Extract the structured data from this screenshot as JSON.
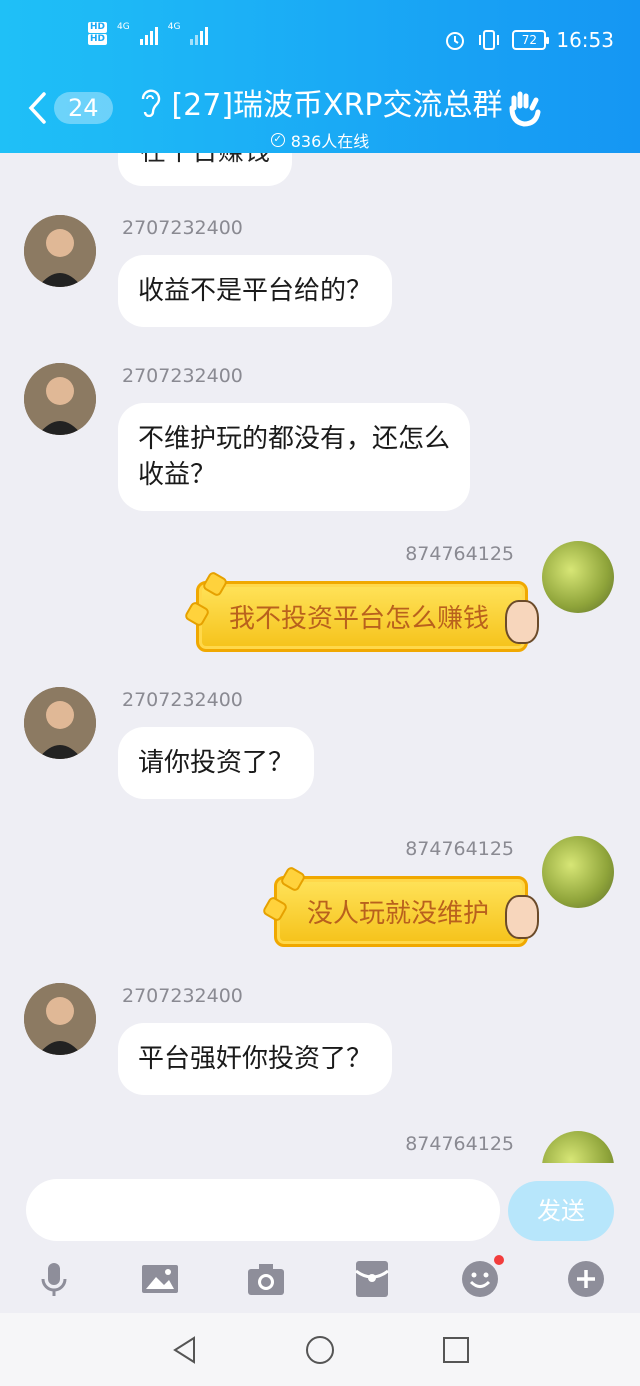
{
  "status": {
    "net1": "4G",
    "net2": "4G",
    "battery": "72",
    "time": "16:53",
    "hd1": "HD",
    "hd2": "HD"
  },
  "header": {
    "unread": "24",
    "title": "[27]瑞波币XRP交流总群",
    "online": "836人在线"
  },
  "partial_message": "在平台赚钱",
  "messages": [
    {
      "sender": "2707232400",
      "text": "收益不是平台给的？",
      "side": "left"
    },
    {
      "sender": "2707232400",
      "text": "不维护玩的都没有，还怎么",
      "text2": "收益？",
      "side": "left"
    },
    {
      "sender": "874764125",
      "text": "我不投资平台怎么赚钱",
      "side": "right"
    },
    {
      "sender": "2707232400",
      "text": "请你投资了？",
      "side": "left"
    },
    {
      "sender": "874764125",
      "text": "没人玩就没维护",
      "side": "right"
    },
    {
      "sender": "2707232400",
      "text": "平台强奸你投资了？",
      "side": "left"
    },
    {
      "sender": "874764125",
      "side": "right"
    }
  ],
  "input": {
    "send_label": "发送",
    "placeholder": ""
  },
  "toolbar": {
    "icons": [
      "microphone-icon",
      "image-icon",
      "camera-icon",
      "red-packet-icon",
      "emoji-icon",
      "plus-icon"
    ]
  },
  "nav": {
    "icons": [
      "back-triangle-icon",
      "home-circle-icon",
      "recents-square-icon"
    ]
  },
  "colors": {
    "header": "#1aa9f5",
    "send": "#b7e6fb",
    "background": "#eeeef4",
    "gold_text": "#b9611d"
  }
}
